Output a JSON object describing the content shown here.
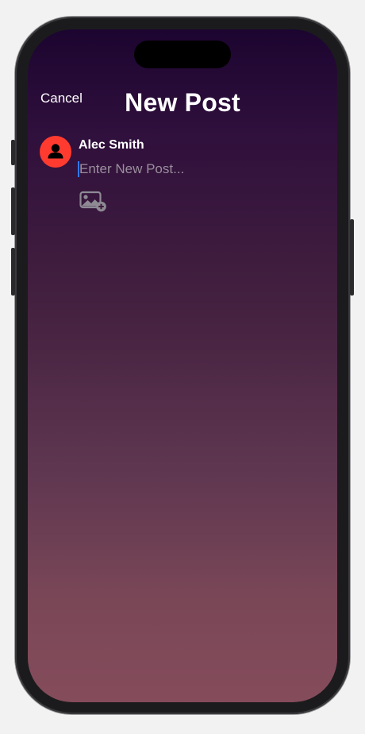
{
  "header": {
    "cancel_label": "Cancel",
    "title": "New Post"
  },
  "composer": {
    "user_name": "Alec Smith",
    "placeholder": "Enter New Post...",
    "value": "",
    "add_photo_icon": "photo-badge-plus-icon",
    "avatar_icon": "person-icon"
  },
  "colors": {
    "avatar_background": "#ff3b30",
    "caret": "#3478f6",
    "gradient_top": "#1c0530",
    "gradient_bottom": "#854c5b"
  }
}
